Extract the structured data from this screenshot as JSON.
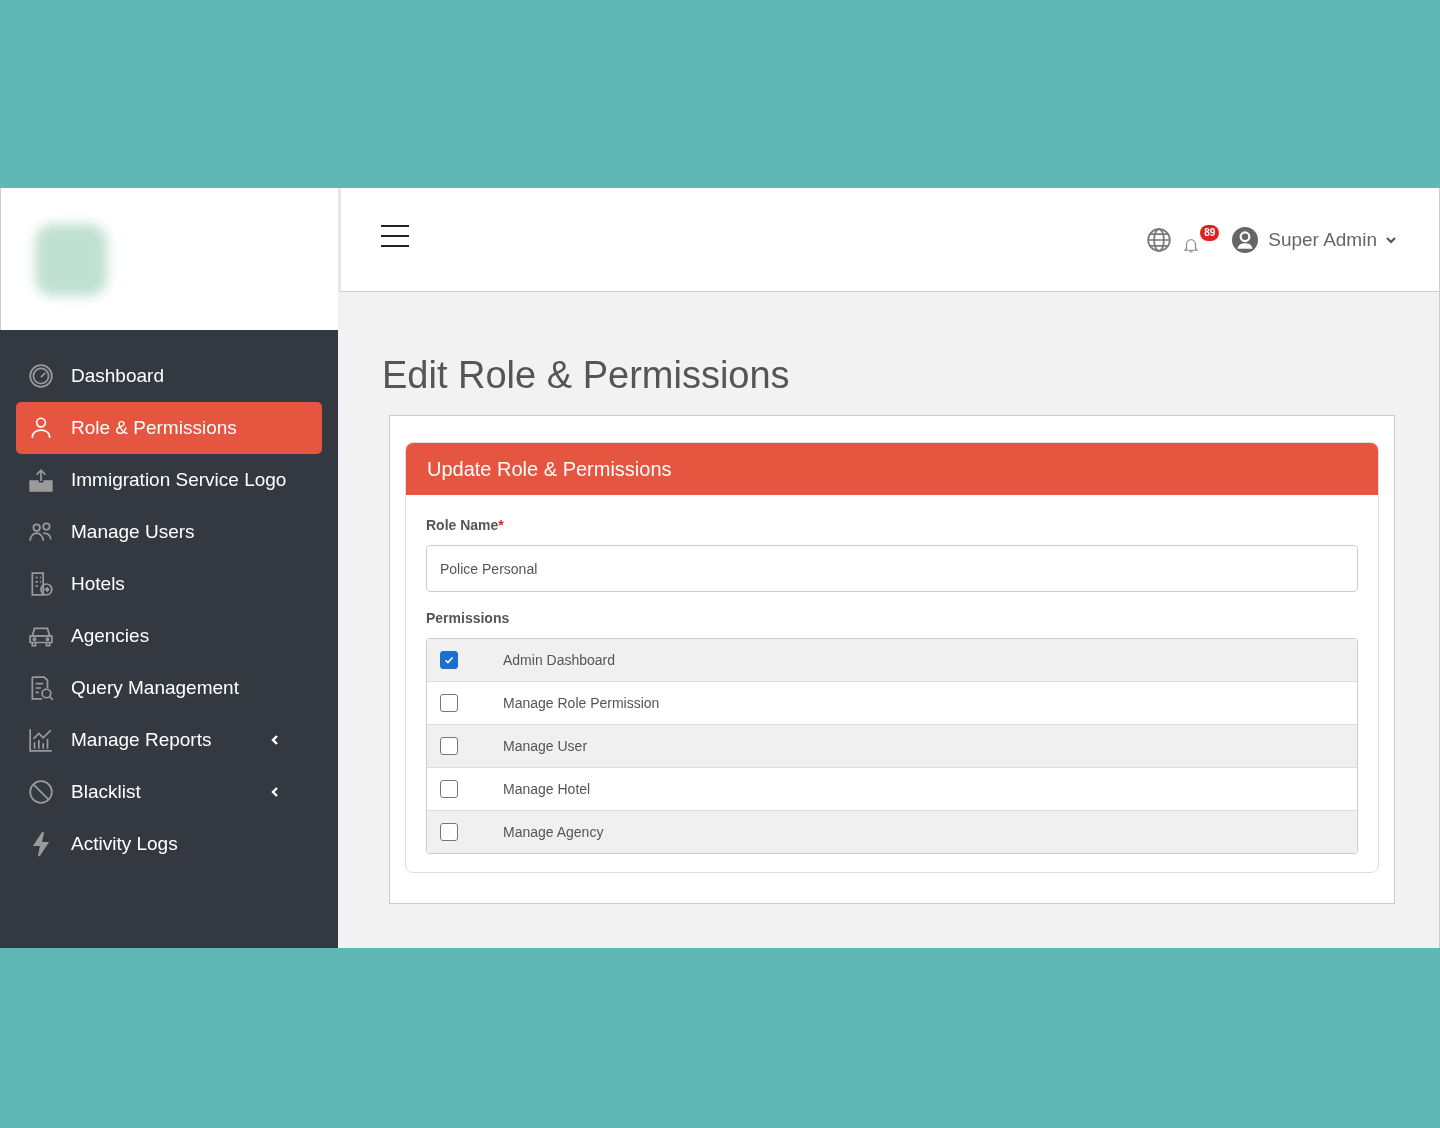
{
  "sidebar": {
    "items": [
      {
        "label": "Dashboard",
        "selected": false,
        "expandable": false
      },
      {
        "label": "Role & Permissions",
        "selected": true,
        "expandable": false
      },
      {
        "label": "Immigration Service Logo",
        "selected": false,
        "expandable": false
      },
      {
        "label": "Manage Users",
        "selected": false,
        "expandable": false
      },
      {
        "label": "Hotels",
        "selected": false,
        "expandable": false
      },
      {
        "label": "Agencies",
        "selected": false,
        "expandable": false
      },
      {
        "label": "Query Management",
        "selected": false,
        "expandable": false
      },
      {
        "label": "Manage Reports",
        "selected": false,
        "expandable": true
      },
      {
        "label": "Blacklist",
        "selected": false,
        "expandable": true
      },
      {
        "label": "Activity Logs",
        "selected": false,
        "expandable": false
      }
    ]
  },
  "header": {
    "notification_count": "89",
    "user_name": "Super Admin"
  },
  "page": {
    "title": "Edit Role & Permissions"
  },
  "form": {
    "title": "Update Role & Permissions",
    "role_name_label": "Role Name",
    "required_mark": "*",
    "role_name_value": "Police Personal",
    "permissions_label": "Permissions",
    "permissions": [
      {
        "label": "Admin Dashboard",
        "checked": true
      },
      {
        "label": "Manage Role Permission",
        "checked": false
      },
      {
        "label": "Manage User",
        "checked": false
      },
      {
        "label": "Manage Hotel",
        "checked": false
      },
      {
        "label": "Manage Agency",
        "checked": false
      }
    ]
  }
}
